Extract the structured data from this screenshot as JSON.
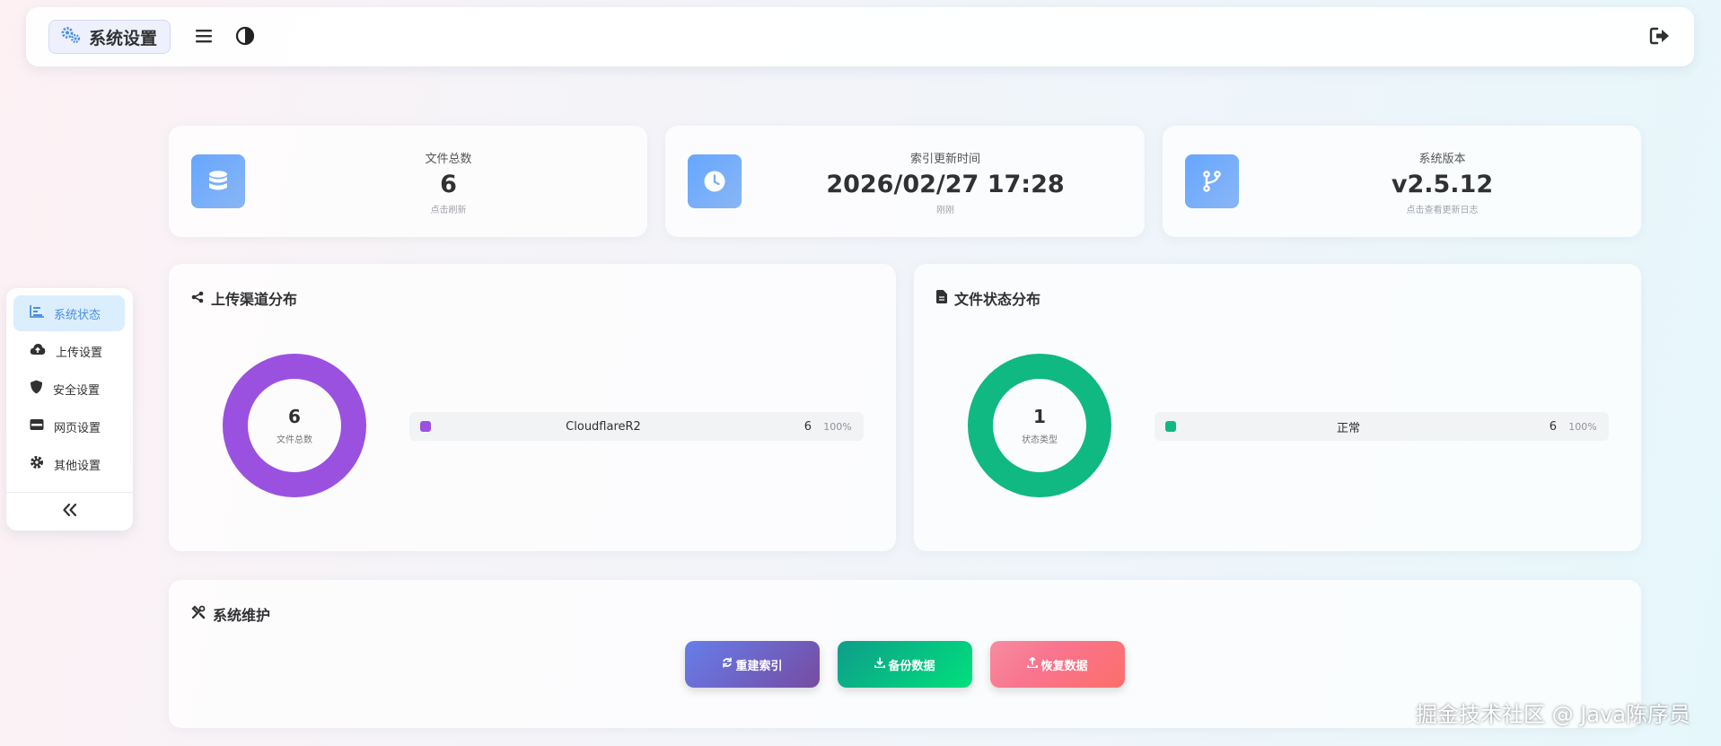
{
  "header": {
    "title": "系统设置",
    "icons": {
      "brand": "gears-icon",
      "menu": "menu-icon",
      "theme": "contrast-icon",
      "logout": "logout-icon"
    }
  },
  "stats": [
    {
      "label": "文件总数",
      "value": "6",
      "sub": "点击刷新",
      "icon": "database-icon"
    },
    {
      "label": "索引更新时间",
      "value": "2026/02/27 17:28",
      "sub": "刚刚",
      "icon": "clock-icon"
    },
    {
      "label": "系统版本",
      "value": "v2.5.12",
      "sub": "点击查看更新日志",
      "icon": "git-branch-icon"
    }
  ],
  "upload_channels": {
    "title": "上传渠道分布",
    "icon": "share-icon",
    "center_value": "6",
    "center_label": "文件总数",
    "color": "#9b51e0",
    "items": [
      {
        "name": "CloudflareR2",
        "count": "6",
        "percent": "100%",
        "fraction": 1.0
      }
    ]
  },
  "file_status": {
    "title": "文件状态分布",
    "icon": "file-icon",
    "center_value": "1",
    "center_label": "状态类型",
    "color": "#10b981",
    "items": [
      {
        "name": "正常",
        "count": "6",
        "percent": "100%",
        "fraction": 1.0
      }
    ]
  },
  "sidebar": {
    "items": [
      {
        "label": "系统状态",
        "icon": "chart-bar-icon",
        "active": true
      },
      {
        "label": "上传设置",
        "icon": "cloud-upload-icon",
        "active": false
      },
      {
        "label": "安全设置",
        "icon": "shield-icon",
        "active": false
      },
      {
        "label": "网页设置",
        "icon": "window-icon",
        "active": false
      },
      {
        "label": "其他设置",
        "icon": "gear-icon",
        "active": false
      }
    ],
    "collapse_icon": "double-chevron-left-icon"
  },
  "maintenance": {
    "title": "系统维护",
    "icon": "tools-icon",
    "buttons": [
      {
        "label": "重建索引",
        "icon": "sync-icon"
      },
      {
        "label": "备份数据",
        "icon": "download-icon"
      },
      {
        "label": "恢复数据",
        "icon": "upload-icon"
      }
    ]
  },
  "watermark": "掘金技术社区 @ Java陈序员",
  "colors": {
    "accent": "#66a6ff",
    "active_nav_bg": "#dbeefe",
    "active_nav_text": "#4a8fe0",
    "upload_channel": "#9b51e0",
    "status_normal": "#10b981",
    "rebuild_btn": "#764ba2",
    "backup_btn": "#00c897",
    "restore_btn": "#fc6076"
  }
}
